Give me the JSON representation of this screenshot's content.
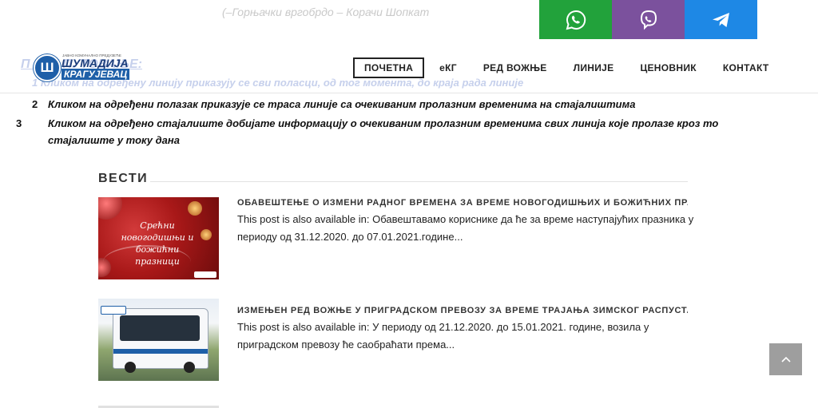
{
  "top_faded_text": "(–Горњачки вргобрдо – Корачи Шопкат",
  "social": [
    {
      "name": "whatsapp-icon",
      "color": "#22a23b"
    },
    {
      "name": "viber-icon",
      "color": "#7b519d"
    },
    {
      "name": "telegram-icon",
      "color": "#1e88e5"
    }
  ],
  "ghost": {
    "heading": "П        ОЈЕ ПУТОВАЊЕ:",
    "line1": "1    Кликом на одређену линију приказују се сви поласци, од тог момента, до краја рада линије"
  },
  "logo": {
    "tiny": "ЈАВНО КОМУНАЛНО ПРЕДУЗЕЋЕ",
    "line1": "ШУМАДИЈА",
    "line2": "КРАГУЈЕВАЦ",
    "mark": "Ш"
  },
  "nav": {
    "items": [
      "ПОЧЕТНА",
      "еКГ",
      "РЕД ВОЖЊЕ",
      "ЛИНИЈЕ",
      "ЦЕНОВНИК",
      "КОНТАКТ"
    ],
    "active": "ПОЧЕТНА"
  },
  "instructions": [
    {
      "num": "2",
      "text": "Кликом на одређени полазак приказује се траса линије са очекиваним пролазним временима на стајалиштима"
    },
    {
      "num": "3",
      "text": "Кликом на одређено стајалиште добијате информацију о очекиваним пролазним временима свих линија које пролазе кроз то стајалиште у току дана"
    }
  ],
  "news": {
    "heading": "ВЕСТИ",
    "posts": [
      {
        "title": "ОБАВЕШТЕЊЕ О ИЗМЕНИ РАДНОГ ВРЕМЕНА ЗА ВРЕМЕ НОВОГОДИШЊИХ И БОЖИЋНИХ ПРАЗНИКА – ЈТП",
        "excerpt": "This post is also available in: Обавештавамо кориснике да ће за време наступајућих празника у периоду од 31.12.2020. до 07.01.2021.године...",
        "thumb_text": "Срећни новогодишњи и божићни празници"
      },
      {
        "title": "ИЗМЕЊЕН РЕД ВОЖЊЕ У ПРИГРАДСКОМ ПРЕВОЗУ ЗА ВРЕМЕ ТРАЈАЊА ЗИМСКОГ РАСПУСТА",
        "excerpt": "This post is also available in: У периоду од 21.12.2020. до 15.01.2021. године, возила у приградском превозу ће саобраћати према...",
        "thumb_text": ""
      }
    ]
  },
  "scroll_top_icon": "chevron-up-icon"
}
